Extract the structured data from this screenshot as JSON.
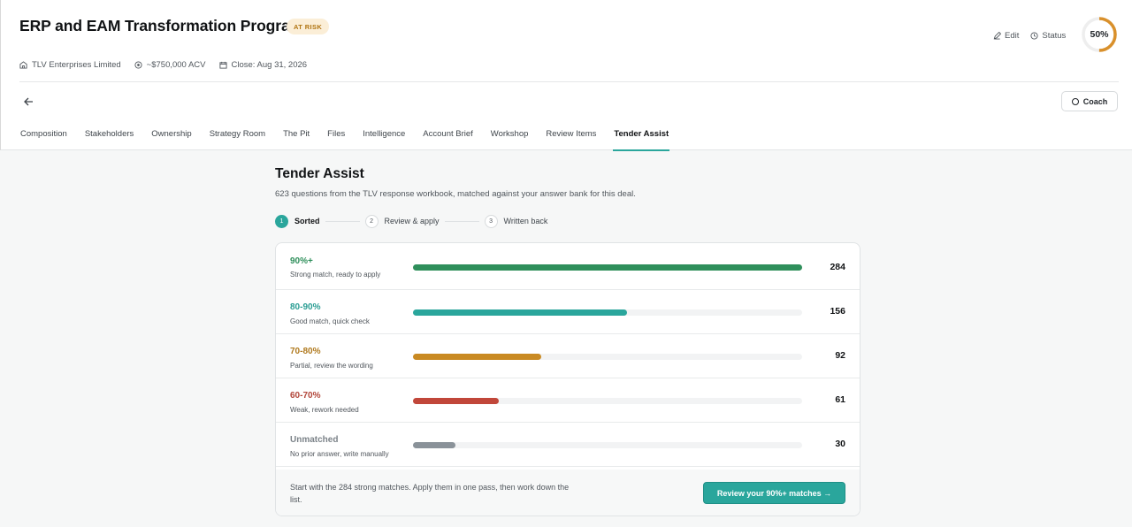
{
  "header": {
    "title": "ERP and EAM Transformation Program",
    "badge": "AT RISK",
    "meta": {
      "company": "TLV Enterprises Limited",
      "acv": "~$750,000 ACV",
      "close": "Close: Aug 31, 2026"
    },
    "actions": {
      "edit": "Edit",
      "status": "Status"
    },
    "progress": {
      "label": "50%",
      "value": 0.5
    }
  },
  "toolbar": {
    "coach": "Coach"
  },
  "tabs": [
    {
      "label": "Composition"
    },
    {
      "label": "Stakeholders"
    },
    {
      "label": "Ownership"
    },
    {
      "label": "Strategy Room"
    },
    {
      "label": "The Pit"
    },
    {
      "label": "Files"
    },
    {
      "label": "Intelligence"
    },
    {
      "label": "Account Brief"
    },
    {
      "label": "Workshop"
    },
    {
      "label": "Review Items"
    },
    {
      "label": "Tender Assist",
      "active": true
    }
  ],
  "main": {
    "title": "Tender Assist",
    "subtitle": "623 questions from the TLV response workbook, matched against your answer bank for this deal.",
    "steps": [
      {
        "num": "1",
        "label": "Sorted"
      },
      {
        "num": "2",
        "label": "Review & apply"
      },
      {
        "num": "3",
        "label": "Written back"
      }
    ],
    "rows": [
      {
        "label": "90%+",
        "desc": "Strong match, ready to apply",
        "count": "284",
        "fill": 1.0,
        "color": "#2f8f5b"
      },
      {
        "label": "80-90%",
        "desc": "Good match, quick check",
        "count": "156",
        "fill": 0.55,
        "color": "#2aa69c"
      },
      {
        "label": "70-80%",
        "desc": "Partial, review the wording",
        "count": "92",
        "fill": 0.33,
        "color": "#c98a23"
      },
      {
        "label": "60-70%",
        "desc": "Weak, rework needed",
        "count": "61",
        "fill": 0.22,
        "color": "#c1473a"
      },
      {
        "label": "Unmatched",
        "desc": "No prior answer, write manually",
        "count": "30",
        "fill": 0.11,
        "color": "#8a9299"
      }
    ],
    "label_colors": [
      "#2f8f5b",
      "#2a9d93",
      "#b07a1f",
      "#b2463a",
      "#7c8389"
    ],
    "footer_text": "Start with the 284 strong matches. Apply them in one pass, then work down the list.",
    "cta": "Review your 90%+ matches →"
  },
  "colors": {
    "accent": "#2aa69c",
    "ring": "#d9902b"
  }
}
